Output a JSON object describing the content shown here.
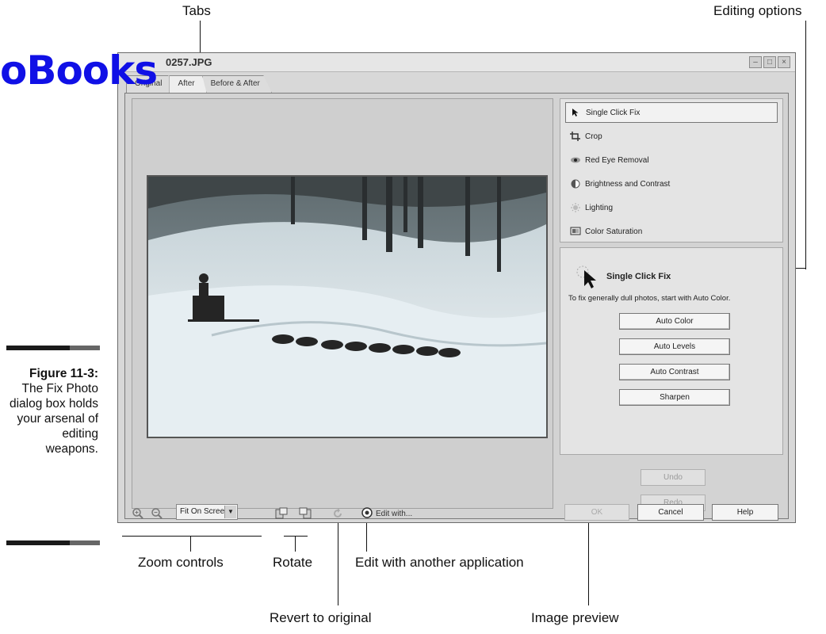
{
  "watermark": "oBooks",
  "callouts": {
    "tabs": "Tabs",
    "editing_options": "Editing options",
    "zoom_controls": "Zoom controls",
    "rotate": "Rotate",
    "edit_with_another": "Edit with another application",
    "revert": "Revert to original",
    "image_preview": "Image preview"
  },
  "caption": {
    "figure": "Figure 11-3:",
    "text": "The Fix Photo dialog box holds your arsenal of editing weapons."
  },
  "window": {
    "title": "0257.JPG",
    "tabs": [
      {
        "label": "Original"
      },
      {
        "label": "After"
      },
      {
        "label": "Before & After"
      }
    ]
  },
  "options": [
    {
      "label": "Single Click Fix",
      "icon": "cursor-icon",
      "selected": true
    },
    {
      "label": "Crop",
      "icon": "crop-icon"
    },
    {
      "label": "Red Eye Removal",
      "icon": "eye-icon"
    },
    {
      "label": "Brightness and Contrast",
      "icon": "brightness-icon"
    },
    {
      "label": "Lighting",
      "icon": "sun-icon"
    },
    {
      "label": "Color Saturation",
      "icon": "color-saturation-icon"
    }
  ],
  "detail": {
    "title": "Single Click Fix",
    "description": "To fix generally dull photos, start with Auto Color.",
    "buttons": [
      "Auto Color",
      "Auto Levels",
      "Auto Contrast",
      "Sharpen"
    ]
  },
  "history": {
    "undo": "Undo",
    "redo": "Redo"
  },
  "toolbar": {
    "zoom_value": "Fit On Screen",
    "edit_with": "Edit with..."
  },
  "footer": {
    "ok": "OK",
    "cancel": "Cancel",
    "help": "Help"
  }
}
